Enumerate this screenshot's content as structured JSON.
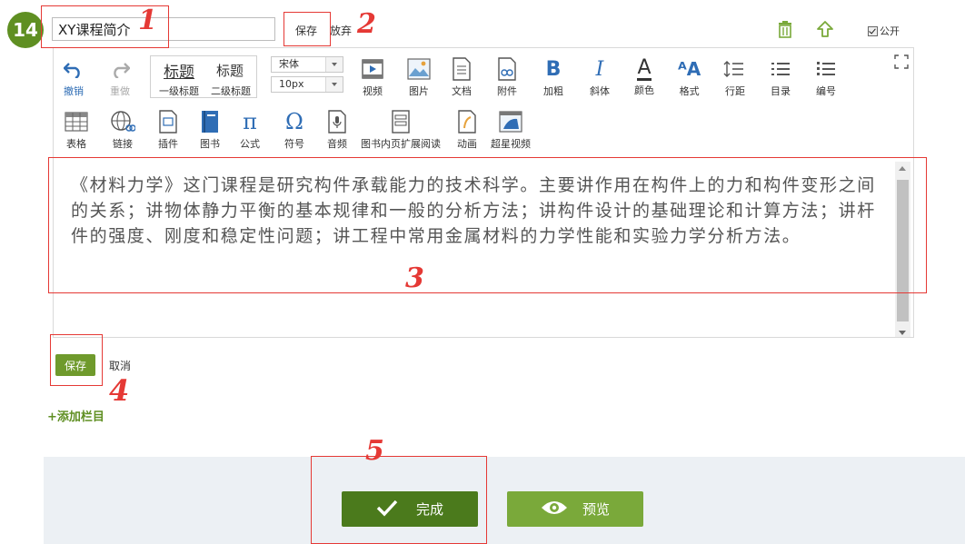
{
  "step_number": "14",
  "header": {
    "title_value": "XY课程简介",
    "save_label": "保存",
    "discard_label": "放弃",
    "public_label": "公开"
  },
  "toolbar": {
    "undo": "撤销",
    "redo": "重做",
    "heading1": "标题",
    "heading2": "标题",
    "heading1_level": "一级标题",
    "heading2_level": "二级标题",
    "font_family": "宋体",
    "font_size": "10px",
    "video": "视频",
    "image": "图片",
    "document": "文档",
    "attachment": "附件",
    "bold": "加粗",
    "italic": "斜体",
    "color": "颜色",
    "format": "格式",
    "line_height": "行距",
    "toc": "目录",
    "numbering": "编号",
    "table": "表格",
    "link": "链接",
    "plugin": "插件",
    "book": "图书",
    "formula": "公式",
    "symbol": "符号",
    "audio": "音频",
    "book_page_reading": "图书内页扩展阅读",
    "animation": "动画",
    "super_video": "超星视频"
  },
  "editor": {
    "content": "《材料力学》这门课程是研究构件承载能力的技术科学。主要讲作用在构件上的力和构件变形之间的关系；讲物体静力平衡的基本规律和一般的分析方法；讲构件设计的基础理论和计算方法；讲杆件的强度、刚度和稳定性问题；讲工程中常用金属材料的力学性能和实验力学分析方法。"
  },
  "actions": {
    "save_label": "保存",
    "cancel_label": "取消",
    "add_column_label": "+添加栏目"
  },
  "footer": {
    "done_label": "完成",
    "preview_label": "预览"
  },
  "annotations": [
    "1",
    "2",
    "3",
    "4",
    "5"
  ],
  "colors": {
    "accent_green": "#6f9a2c",
    "dark_green": "#4b7a1c",
    "annotation_red": "#e53935",
    "toolbar_blue": "#2f6db5"
  }
}
